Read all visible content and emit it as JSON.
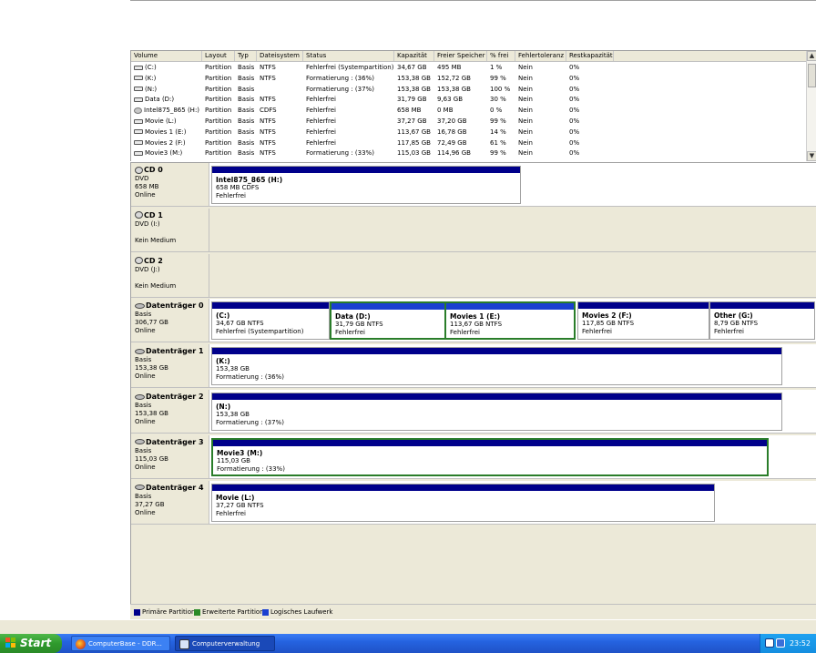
{
  "volume_list": {
    "columns": [
      "Volume",
      "Layout",
      "Typ",
      "Dateisystem",
      "Status",
      "Kapazität",
      "Freier Speicher",
      "% frei",
      "Fehlertoleranz",
      "Restkapazität"
    ],
    "rows": [
      {
        "icon": "drive-icon",
        "cells": [
          "(C:)",
          "Partition",
          "Basis",
          "NTFS",
          "Fehlerfrei (Systempartition)",
          "34,67 GB",
          "495 MB",
          "1 %",
          "Nein",
          "0%"
        ]
      },
      {
        "icon": "drive-icon",
        "cells": [
          "(K:)",
          "Partition",
          "Basis",
          "NTFS",
          "Formatierung : (36%)",
          "153,38 GB",
          "152,72 GB",
          "99 %",
          "Nein",
          "0%"
        ]
      },
      {
        "icon": "drive-icon",
        "cells": [
          "(N:)",
          "Partition",
          "Basis",
          "",
          "Formatierung : (37%)",
          "153,38 GB",
          "153,38 GB",
          "100 %",
          "Nein",
          "0%"
        ]
      },
      {
        "icon": "drive-icon",
        "cells": [
          "Data (D:)",
          "Partition",
          "Basis",
          "NTFS",
          "Fehlerfrei",
          "31,79 GB",
          "9,63 GB",
          "30 %",
          "Nein",
          "0%"
        ]
      },
      {
        "icon": "cd-icon",
        "cells": [
          "Intel875_865 (H:)",
          "Partition",
          "Basis",
          "CDFS",
          "Fehlerfrei",
          "658 MB",
          "0 MB",
          "0 %",
          "Nein",
          "0%"
        ]
      },
      {
        "icon": "drive-icon",
        "cells": [
          "Movie (L:)",
          "Partition",
          "Basis",
          "NTFS",
          "Fehlerfrei",
          "37,27 GB",
          "37,20 GB",
          "99 %",
          "Nein",
          "0%"
        ]
      },
      {
        "icon": "drive-icon",
        "cells": [
          "Movies 1 (E:)",
          "Partition",
          "Basis",
          "NTFS",
          "Fehlerfrei",
          "113,67 GB",
          "16,78 GB",
          "14 %",
          "Nein",
          "0%"
        ]
      },
      {
        "icon": "drive-icon",
        "cells": [
          "Movies 2 (F:)",
          "Partition",
          "Basis",
          "NTFS",
          "Fehlerfrei",
          "117,85 GB",
          "72,49 GB",
          "61 %",
          "Nein",
          "0%"
        ]
      },
      {
        "icon": "drive-icon",
        "cells": [
          "Movie3 (M:)",
          "Partition",
          "Basis",
          "NTFS",
          "Formatierung : (33%)",
          "115,03 GB",
          "114,96 GB",
          "99 %",
          "Nein",
          "0%"
        ]
      }
    ]
  },
  "disks": [
    {
      "title": "CD 0",
      "icon": "cd-icon",
      "lines": [
        "DVD",
        "658 MB",
        "Online"
      ],
      "partitions": [
        {
          "name": "Intel875_865 (H:)",
          "l1": "658 MB CDFS",
          "l2": "Fehlerfrei"
        }
      ]
    },
    {
      "title": "CD 1",
      "icon": "cd-icon",
      "lines": [
        "DVD (I:)",
        "",
        "Kein Medium"
      ],
      "partitions": []
    },
    {
      "title": "CD 2",
      "icon": "cd-icon",
      "lines": [
        "DVD (J:)",
        "",
        "Kein Medium"
      ],
      "partitions": []
    },
    {
      "title": "Datenträger 0",
      "icon": "disk-icon",
      "lines": [
        "Basis",
        "306,77 GB",
        "Online"
      ],
      "partitions": [
        {
          "name": "(C:)",
          "l1": "34,67 GB NTFS",
          "l2": "Fehlerfrei (Systempartition)"
        },
        {
          "name": "Data  (D:)",
          "l1": "31,79 GB NTFS",
          "l2": "Fehlerfrei"
        },
        {
          "name": "Movies 1  (E:)",
          "l1": "113,67 GB NTFS",
          "l2": "Fehlerfrei"
        },
        {
          "name": "Movies 2  (F:)",
          "l1": "117,85 GB NTFS",
          "l2": "Fehlerfrei"
        },
        {
          "name": "Other  (G:)",
          "l1": "8,79 GB NTFS",
          "l2": "Fehlerfrei"
        }
      ]
    },
    {
      "title": "Datenträger 1",
      "icon": "disk-icon",
      "lines": [
        "Basis",
        "153,38 GB",
        "Online"
      ],
      "partitions": [
        {
          "name": "(K:)",
          "l1": "153,38 GB",
          "l2": "Formatierung : (36%)"
        }
      ]
    },
    {
      "title": "Datenträger 2",
      "icon": "disk-icon",
      "lines": [
        "Basis",
        "153,38 GB",
        "Online"
      ],
      "partitions": [
        {
          "name": "(N:)",
          "l1": "153,38 GB",
          "l2": "Formatierung : (37%)"
        }
      ]
    },
    {
      "title": "Datenträger 3",
      "icon": "disk-icon",
      "lines": [
        "Basis",
        "115,03 GB",
        "Online"
      ],
      "partitions": [
        {
          "name": "Movie3  (M:)",
          "l1": "115,03 GB",
          "l2": "Formatierung : (33%)"
        }
      ]
    },
    {
      "title": "Datenträger 4",
      "icon": "disk-icon",
      "lines": [
        "Basis",
        "37,27 GB",
        "Online"
      ],
      "partitions": [
        {
          "name": "Movie  (L:)",
          "l1": "37,27 GB NTFS",
          "l2": "Fehlerfrei"
        }
      ]
    }
  ],
  "legend": [
    {
      "label": "Primäre Partition",
      "color": "#00008b"
    },
    {
      "label": "Erweiterte Partition",
      "color": "#2a8a27"
    },
    {
      "label": "Logisches Laufwerk",
      "color": "#1a3fd0"
    }
  ],
  "taskbar": {
    "start_label": "Start",
    "tasks": [
      {
        "label": "ComputerBase - DDR...",
        "icon": "firefox-icon",
        "active": false
      },
      {
        "label": "Computerverwaltung",
        "icon": "computer-management-icon",
        "active": true
      }
    ],
    "clock": "23:52"
  },
  "colors": {
    "primary_partition": "#00008b",
    "selected_border": "#2a7d2a",
    "taskbar": "#2563e0"
  }
}
